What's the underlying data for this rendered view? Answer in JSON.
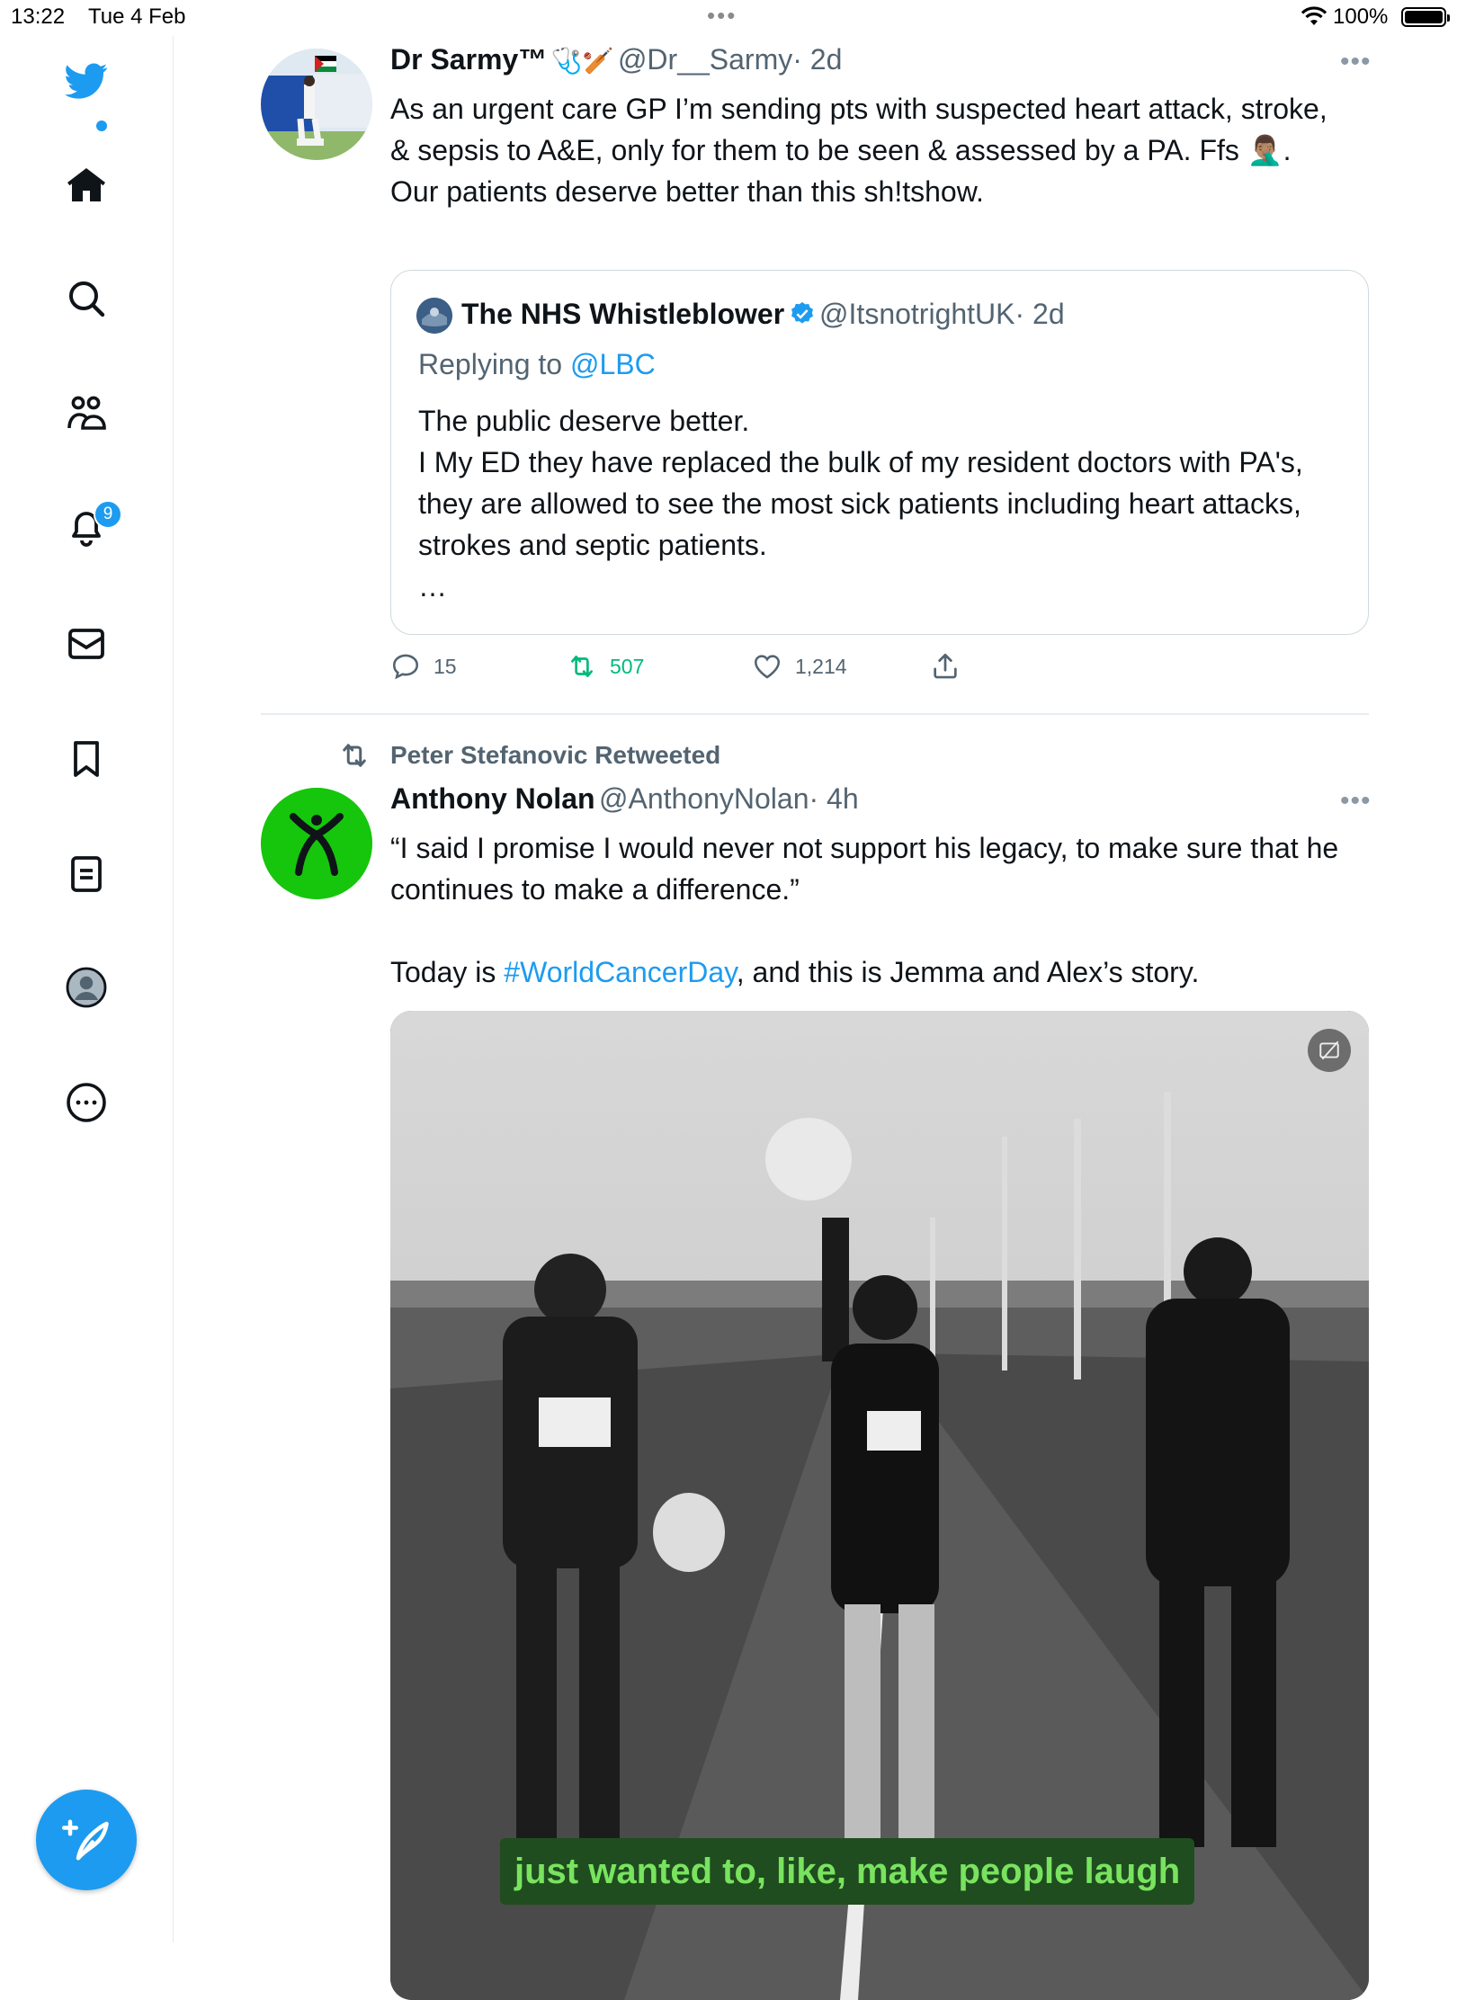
{
  "status_bar": {
    "time": "13:22",
    "date": "Tue 4 Feb",
    "battery": "100%"
  },
  "sidebar": {
    "items": [
      {
        "icon": "twitter-bird-icon"
      },
      {
        "icon": "home-icon"
      },
      {
        "icon": "search-icon"
      },
      {
        "icon": "communities-icon"
      },
      {
        "icon": "bell-icon"
      },
      {
        "icon": "mail-icon"
      },
      {
        "icon": "bookmark-icon"
      },
      {
        "icon": "lists-icon"
      },
      {
        "icon": "profile-icon"
      },
      {
        "icon": "more-icon"
      }
    ],
    "notifications_badge": "9",
    "compose_icon": "compose-feather-icon",
    "accent": "#1d9bf0"
  },
  "tweets": [
    {
      "name": "Dr Sarmy™",
      "name_emoji": "🩺🏏",
      "handle": "@Dr__Sarmy",
      "age": "· 2d",
      "text": "As an urgent care GP I’m sending pts with suspected heart attack, stroke, & sepsis to A&E, only for them to be seen & assessed by a PA. Ffs 🤦🏽‍♂️.\nOur patients deserve better than this sh!tshow.",
      "quote": {
        "name": "The NHS Whistleblower",
        "handle": "@ItsnotrightUK",
        "age": "· 2d",
        "replying_prefix": "Replying to",
        "replying_to": "@LBC",
        "text": "The public deserve better.\nI My ED they have replaced the bulk of my resident doctors with PA's, they are allowed to see the most sick patients including heart attacks, strokes and septic patients.\n…"
      },
      "actions": {
        "replies": "15",
        "retweets": "507",
        "likes": "1,214"
      },
      "retweet_color": "#00ba7c"
    },
    {
      "retweeted_by": "Peter Stefanovic Retweeted",
      "name": "Anthony Nolan",
      "handle": "@AnthonyNolan",
      "age": "· 4h",
      "text_line1": "“I said I promise I would never not support his legacy, to make sure that he continues to make a difference.”",
      "text_prefix": "Today is ",
      "hashtag": "#WorldCancerDay",
      "text_suffix": ", and this is Jemma and Alex’s story.",
      "avatar_color": "#16c60c",
      "media_caption": "just wanted to, like, make people laugh",
      "caption_color": "#79e35f"
    }
  ]
}
